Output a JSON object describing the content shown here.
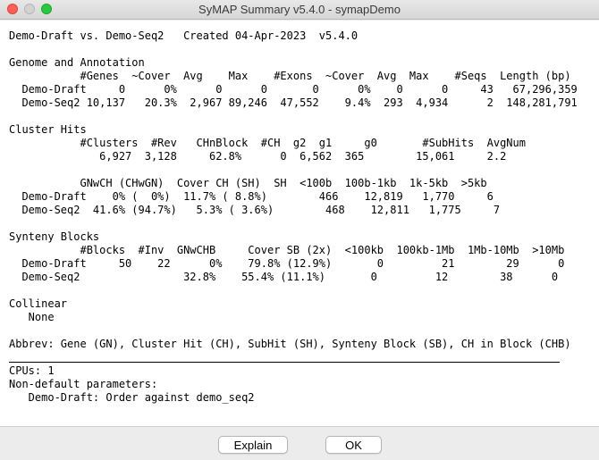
{
  "window": {
    "title": "SyMAP Summary v5.4.0 - symapDemo"
  },
  "summary": {
    "lines": [
      "Demo-Draft vs. Demo-Seq2   Created 04-Apr-2023  v5.4.0",
      "",
      "Genome and Annotation",
      "           #Genes  ~Cover  Avg    Max    #Exons  ~Cover  Avg  Max    #Seqs  Length (bp)",
      "  Demo-Draft     0      0%      0      0       0      0%    0      0     43   67,296,359",
      "  Demo-Seq2 10,137   20.3%  2,967 89,246  47,552    9.4%  293  4,934      2  148,281,791",
      "",
      "Cluster Hits",
      "           #Clusters  #Rev   CHnBlock  #CH  g2  g1     g0       #SubHits  AvgNum",
      "              6,927  3,128     62.8%      0  6,562  365        15,061     2.2",
      "",
      "           GNwCH (CHwGN)  Cover CH (SH)  SH  <100b  100b-1kb  1k-5kb  >5kb",
      "  Demo-Draft    0% (  0%)  11.7% ( 8.8%)        466    12,819   1,770     6",
      "  Demo-Seq2  41.6% (94.7%)   5.3% ( 3.6%)        468    12,811   1,775     7",
      "",
      "Synteny Blocks",
      "           #Blocks  #Inv  GNwCHB     Cover SB (2x)  <100kb  100kb-1Mb  1Mb-10Mb  >10Mb",
      "  Demo-Draft     50    22      0%    79.8% (12.9%)       0         21        29      0",
      "  Demo-Seq2                32.8%    55.4% (11.1%)       0         12        38      0",
      "",
      "Collinear",
      "   None",
      "",
      "Abbrev: Gene (GN), Cluster Hit (CH), SubHit (SH), Synteny Block (SB), CH in Block (CHB)",
      ""
    ],
    "footer_lines": [
      "CPUs: 1",
      "Non-default parameters:",
      "   Demo-Draft: Order against demo_seq2"
    ]
  },
  "buttons": {
    "explain": "Explain",
    "ok": "OK"
  }
}
